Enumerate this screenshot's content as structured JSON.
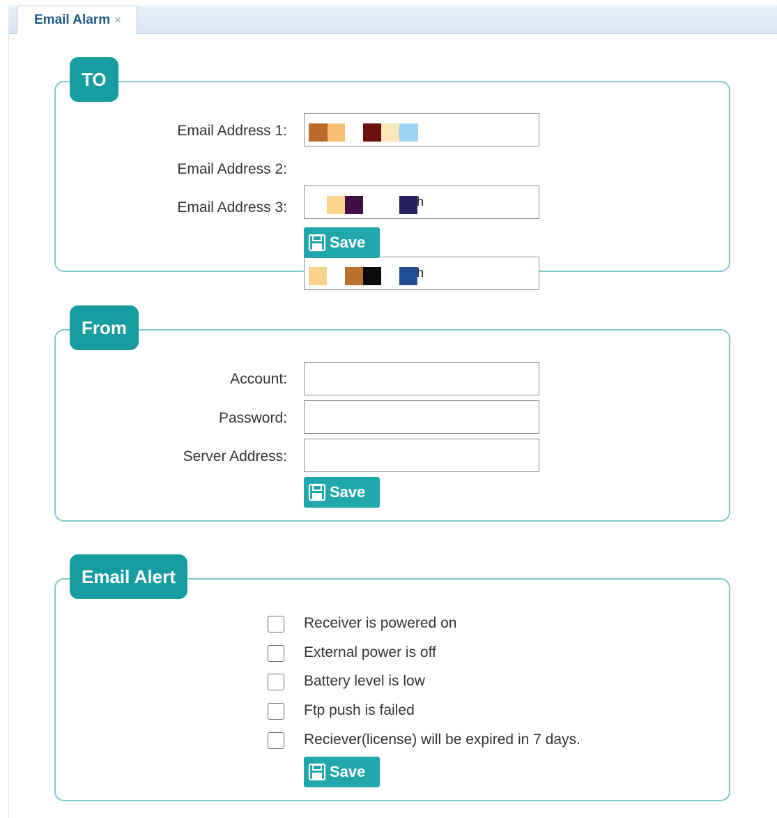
{
  "tab": {
    "label": "Email Alarm",
    "close": "×"
  },
  "to_section": {
    "legend": "TO",
    "fields": [
      {
        "label": "Email Address 1:",
        "value": ""
      },
      {
        "label": "Email Address 2:",
        "value": ""
      },
      {
        "label": "Email Address 3:",
        "value": ""
      }
    ],
    "redacted_tail_2": "h",
    "redacted_tail_3": "h",
    "save_label": "Save"
  },
  "from_section": {
    "legend": "From",
    "fields": [
      {
        "label": "Account:",
        "value": ""
      },
      {
        "label": "Password:",
        "value": ""
      },
      {
        "label": "Server Address:",
        "value": ""
      }
    ],
    "save_label": "Save"
  },
  "alert_section": {
    "legend": "Email Alert",
    "options": [
      {
        "label": "Receiver is powered on",
        "checked": false
      },
      {
        "label": "External power is off",
        "checked": false
      },
      {
        "label": "Battery level is low",
        "checked": false
      },
      {
        "label": "Ftp push is failed",
        "checked": false
      },
      {
        "label": "Reciever(license) will be expired in 7 days.",
        "checked": false
      }
    ],
    "save_label": "Save"
  },
  "colors": {
    "accent": "#179c9f",
    "button": "#1fa7ab",
    "panel_border": "#7fc8ca",
    "tab_text": "#1e5b86"
  }
}
